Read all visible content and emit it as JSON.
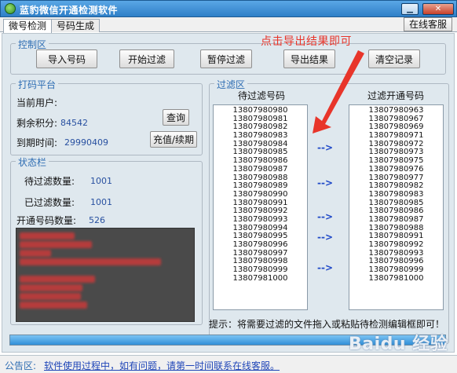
{
  "window": {
    "title": "蓝豹微信开通检测软件"
  },
  "tabs": [
    {
      "label": "微号检测"
    },
    {
      "label": "号码生成"
    }
  ],
  "support_button": "在线客服",
  "annotation": "点击导出结果即可",
  "control": {
    "label": "控制区",
    "buttons": {
      "import": "导入号码",
      "start": "开始过滤",
      "pause": "暂停过滤",
      "export": "导出结果",
      "clear": "清空记录"
    }
  },
  "platform": {
    "label": "打码平台",
    "user_label": "当前用户:",
    "points_label": "剩余积分:",
    "points_value": "84542",
    "expiry_label": "到期时间:",
    "expiry_value": "29990409",
    "query_button": "查询",
    "recharge_button": "充值/续期"
  },
  "status_panel": {
    "label": "状态栏",
    "pending_label": "待过滤数量:",
    "pending_value": "1001",
    "filtered_label": "已过滤数量:",
    "filtered_value": "1001",
    "opened_label": "开通号码数量:",
    "opened_value": "526"
  },
  "filter": {
    "label": "过滤区",
    "source_header": "待过滤号码",
    "result_header": "过滤开通号码",
    "flow_arrow": "-->",
    "source_numbers": [
      "13807980980",
      "13807980981",
      "13807980982",
      "13807980983",
      "13807980984",
      "13807980985",
      "13807980986",
      "13807980987",
      "13807980988",
      "13807980989",
      "13807980990",
      "13807980991",
      "13807980992",
      "13807980993",
      "13807980994",
      "13807980995",
      "13807980996",
      "13807980997",
      "13807980998",
      "13807980999",
      "13807981000"
    ],
    "result_numbers": [
      "13807980963",
      "13807980967",
      "13807980969",
      "13807980971",
      "13807980972",
      "13807980973",
      "13807980975",
      "13807980976",
      "13807980977",
      "13807980982",
      "13807980983",
      "13807980985",
      "13807980986",
      "13807980987",
      "13807980988",
      "13807980991",
      "13807980992",
      "13807980993",
      "13807980996",
      "13807980999",
      "13807981000"
    ],
    "hint": "提示：将需要过滤的文件拖入或粘贴待检测编辑框即可！"
  },
  "progress": {
    "value": 1.0
  },
  "notice": {
    "label": "公告区:",
    "message": "软件使用过程中，如有问题，请第一时间联系在线客服。"
  },
  "watermark": "Baidu 经验",
  "colors": {
    "title_bar": "#2f7fc7",
    "panel_bg": "#dfe8ee",
    "accent_red": "#e8352a",
    "group_label": "#2e6db3",
    "log_bg": "#4a4a4a"
  }
}
